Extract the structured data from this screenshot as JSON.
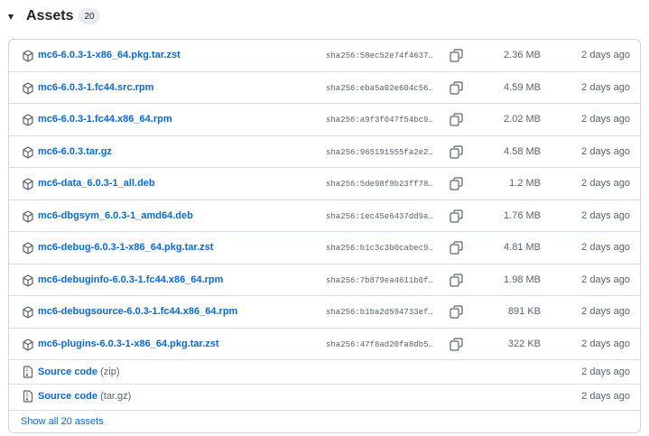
{
  "section": {
    "title": "Assets",
    "count": "20"
  },
  "assets": [
    {
      "name": "mc6-6.0.3-1-x86_64.pkg.tar.zst",
      "sha": "sha256:58ec52e74f4637…",
      "size": "2.36 MB",
      "date": "2 days ago",
      "icon": "package-icon"
    },
    {
      "name": "mc6-6.0.3-1.fc44.src.rpm",
      "sha": "sha256:eba5a02e604c56…",
      "size": "4.59 MB",
      "date": "2 days ago",
      "icon": "package-icon"
    },
    {
      "name": "mc6-6.0.3-1.fc44.x86_64.rpm",
      "sha": "sha256:a9f3f047f54bc9…",
      "size": "2.02 MB",
      "date": "2 days ago",
      "icon": "package-icon"
    },
    {
      "name": "mc6-6.0.3.tar.gz",
      "sha": "sha256:965191555fa2e2…",
      "size": "4.58 MB",
      "date": "2 days ago",
      "icon": "package-icon"
    },
    {
      "name": "mc6-data_6.0.3-1_all.deb",
      "sha": "sha256:5de98f9b23ff78…",
      "size": "1.2 MB",
      "date": "2 days ago",
      "icon": "package-icon"
    },
    {
      "name": "mc6-dbgsym_6.0.3-1_amd64.deb",
      "sha": "sha256:1ec45e6437dd9a…",
      "size": "1.76 MB",
      "date": "2 days ago",
      "icon": "package-icon"
    },
    {
      "name": "mc6-debug-6.0.3-1-x86_64.pkg.tar.zst",
      "sha": "sha256:b1c3c3b0cabec9…",
      "size": "4.81 MB",
      "date": "2 days ago",
      "icon": "package-icon"
    },
    {
      "name": "mc6-debuginfo-6.0.3-1.fc44.x86_64.rpm",
      "sha": "sha256:7b879ea4611b0f…",
      "size": "1.98 MB",
      "date": "2 days ago",
      "icon": "package-icon"
    },
    {
      "name": "mc6-debugsource-6.0.3-1.fc44.x86_64.rpm",
      "sha": "sha256:b1ba2d594733ef…",
      "size": "891 KB",
      "date": "2 days ago",
      "icon": "package-icon"
    },
    {
      "name": "mc6-plugins-6.0.3-1-x86_64.pkg.tar.zst",
      "sha": "sha256:47f8ad20fa8db5…",
      "size": "322 KB",
      "date": "2 days ago",
      "icon": "package-icon"
    }
  ],
  "source": [
    {
      "label": "Source code",
      "suffix": "(zip)",
      "date": "2 days ago",
      "icon": "file-zip-icon"
    },
    {
      "label": "Source code",
      "suffix": "(tar.gz)",
      "date": "2 days ago",
      "icon": "file-zip-icon"
    }
  ],
  "footer": {
    "show_all": "Show all 20 assets"
  },
  "colors": {
    "link": "#0969da",
    "muted": "#59636e",
    "border": "#d0d7de",
    "text": "#1f2328"
  }
}
